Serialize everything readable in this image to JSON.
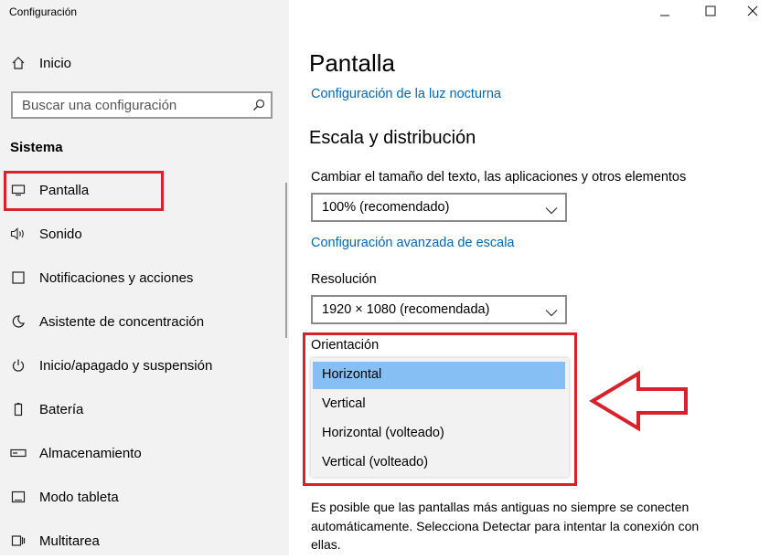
{
  "window": {
    "title": "Configuración",
    "controls": [
      "minimize-icon",
      "maximize-icon",
      "close-icon"
    ]
  },
  "sidebar": {
    "home_label": "Inicio",
    "search_placeholder": "Buscar una configuración",
    "section": "Sistema",
    "items": [
      {
        "label": "Pantalla",
        "icon": "monitor-icon"
      },
      {
        "label": "Sonido",
        "icon": "speaker-icon"
      },
      {
        "label": "Notificaciones y acciones",
        "icon": "notification-icon"
      },
      {
        "label": "Asistente de concentración",
        "icon": "moon-icon"
      },
      {
        "label": "Inicio/apagado y suspensión",
        "icon": "power-icon"
      },
      {
        "label": "Batería",
        "icon": "battery-icon"
      },
      {
        "label": "Almacenamiento",
        "icon": "storage-icon"
      },
      {
        "label": "Modo tableta",
        "icon": "tablet-icon"
      },
      {
        "label": "Multitarea",
        "icon": "multitask-icon"
      }
    ]
  },
  "main": {
    "title": "Pantalla",
    "night_light_link": "Configuración de la luz nocturna",
    "scale_heading": "Escala y distribución",
    "scale_label": "Cambiar el tamaño del texto, las aplicaciones y otros elementos",
    "scale_value": "100% (recomendado)",
    "advanced_scale_link": "Configuración avanzada de escala",
    "resolution_label": "Resolución",
    "resolution_value": "1920 × 1080 (recomendada)",
    "orientation_label": "Orientación",
    "orientation_options": [
      "Horizontal",
      "Vertical",
      "Horizontal (volteado)",
      "Vertical (volteado)"
    ],
    "orientation_selected": "Horizontal",
    "info_text": "Es posible que las pantallas más antiguas no siempre se conecten automáticamente. Selecciona Detectar para intentar la conexión con ellas."
  },
  "colors": {
    "accent_link": "#0067b8",
    "selected_option": "#86bff3",
    "annotation_red": "#d9212c"
  }
}
